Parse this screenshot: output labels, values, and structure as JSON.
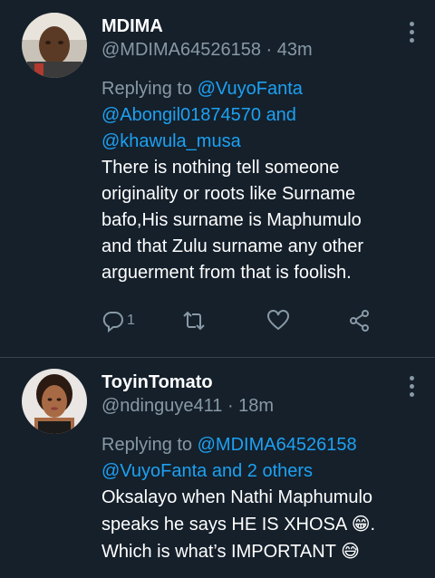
{
  "tweets": [
    {
      "name": "MDIMA",
      "handle": "@MDIMA64526158",
      "separator": "·",
      "time": "43m",
      "replying_prefix": "Replying to ",
      "replying_line1": "@VuyoFanta",
      "replying_line2": "@Abongil01874570 and",
      "replying_line3": "@khawula_musa",
      "text_lines": [
        "There is nothing tell someone",
        "originality or roots like Surname",
        "bafo,His surname is Maphumulo",
        "and that Zulu surname any other",
        "arguerment from that is foolish."
      ],
      "reply_count": "1",
      "icons": [
        "reply-icon",
        "retweet-icon",
        "like-icon",
        "share-icon"
      ]
    },
    {
      "name": "ToyinTomato",
      "handle": "@ndinguye411",
      "separator": "·",
      "time": "18m",
      "replying_prefix": "Replying to ",
      "replying_line1": "@MDIMA64526158",
      "replying_line2": "@VuyoFanta and 2 others",
      "text_line1": "Oksalayo when Nathi Maphumulo",
      "text_line2_a": "speaks he says HE IS XHOSA ",
      "text_line2_emoji": "😁",
      "text_line2_b": ".",
      "text_line3_a": "Which is what’s IMPORTANT ",
      "text_line3_emoji": "😅"
    }
  ],
  "colors": {
    "background": "#15202b",
    "text": "#ffffff",
    "secondary": "#8899a6",
    "link": "#1da1f2",
    "divider": "#38444d"
  }
}
